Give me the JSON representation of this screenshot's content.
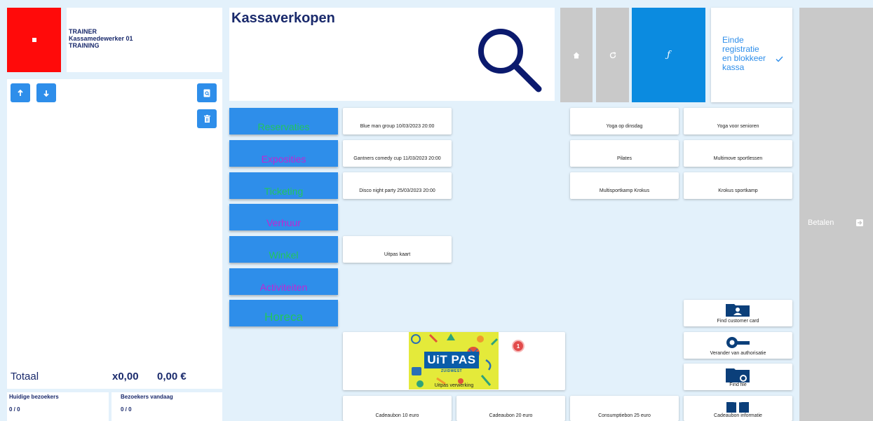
{
  "user": {
    "role": "TRAINER",
    "name": "Kassamedewerker 01",
    "mode": "TRAINING"
  },
  "sidebar": {
    "total_label": "Totaal",
    "total_qty": "x0,00",
    "total_amount": "0,00 €",
    "current_visitors_label": "Huidige bezoekers",
    "current_visitors_value": "0 / 0",
    "visitors_today_label": "Bezoekers vandaag",
    "visitors_today_value": "0 / 0"
  },
  "header": {
    "title": "Kassaverkopen"
  },
  "toolbar": {
    "end_label": "Einde registratie en blokkeer kassa",
    "f_label": "ƒ"
  },
  "pay": {
    "label": "Betalen"
  },
  "categories": [
    {
      "label": "Reservaties",
      "color": "#22c55e"
    },
    {
      "label": "Exposities",
      "color": "#c026d3"
    },
    {
      "label": "Ticketing",
      "color": "#22c55e"
    },
    {
      "label": "Verhuur",
      "color": "#c026d3"
    },
    {
      "label": "Winkel",
      "color": "#22c55e"
    },
    {
      "label": "Activiteiten",
      "color": "#c026d3"
    },
    {
      "label": "Horeca",
      "color": "#22c55e"
    }
  ],
  "events": [
    "Blue man group 10/03/2023 20:00",
    "Gantners comedy cup 11/03/2023 20:00",
    "Disco night party 25/03/2023 20:00"
  ],
  "uitpas_kaart": "Uitpas kaart",
  "activities": [
    "Yoga op dinsdag",
    "Yoga voor senioren",
    "Pilates",
    "Multimove sportlessen",
    "Multisportkamp Krokus",
    "Krokus sportkamp"
  ],
  "tools": [
    "Find customer card",
    "Verander van authorisatie",
    "Find file",
    "Cadeaubon informatie"
  ],
  "uitpas_verwerking": {
    "label": "Uitpas verwerking",
    "logo_text": "UiT PAS",
    "logo_sub": "ZUIDWEST",
    "badge": "1"
  },
  "vouchers": [
    "Cadeaubon 10 euro",
    "Cadeaubon 20  euro",
    "Consumptiebon 25 euro"
  ]
}
